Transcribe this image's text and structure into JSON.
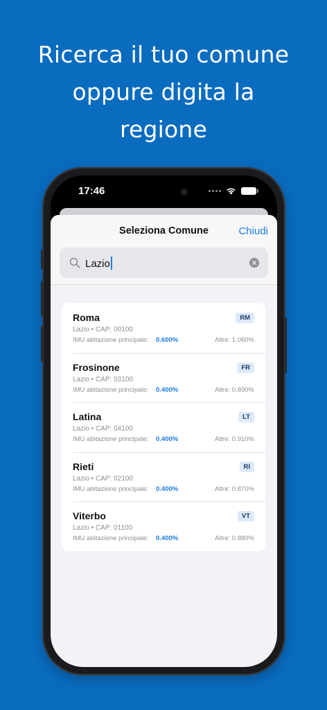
{
  "headline": [
    "Ricerca il tuo comune",
    "oppure digita la",
    "regione"
  ],
  "status_bar": {
    "time": "17:46"
  },
  "sheet": {
    "title": "Seleziona Comune",
    "close_label": "Chiudi"
  },
  "search": {
    "value": "Lazio"
  },
  "labels": {
    "imu": "IMU abitazione principale:"
  },
  "comuni": [
    {
      "name": "Roma",
      "code": "RM",
      "meta": "Lazio • CAP: 00100",
      "imu": "0.600%",
      "altre": "Altre: 1.060%"
    },
    {
      "name": "Frosinone",
      "code": "FR",
      "meta": "Lazio • CAP: 03100",
      "imu": "0.400%",
      "altre": "Altre: 0.890%"
    },
    {
      "name": "Latina",
      "code": "LT",
      "meta": "Lazio • CAP: 04100",
      "imu": "0.400%",
      "altre": "Altre: 0.910%"
    },
    {
      "name": "Rieti",
      "code": "RI",
      "meta": "Lazio • CAP: 02100",
      "imu": "0.400%",
      "altre": "Altre: 0.870%"
    },
    {
      "name": "Viterbo",
      "code": "VT",
      "meta": "Lazio • CAP: 01100",
      "imu": "0.400%",
      "altre": "Altre: 0.880%"
    }
  ],
  "colors": {
    "background": "#0a6cbf",
    "accent": "#1b7ce0",
    "badge_bg": "#dce9f8"
  },
  "icons": [
    "search-icon",
    "clear-icon",
    "wifi-icon",
    "battery-icon",
    "cellular-icon"
  ]
}
